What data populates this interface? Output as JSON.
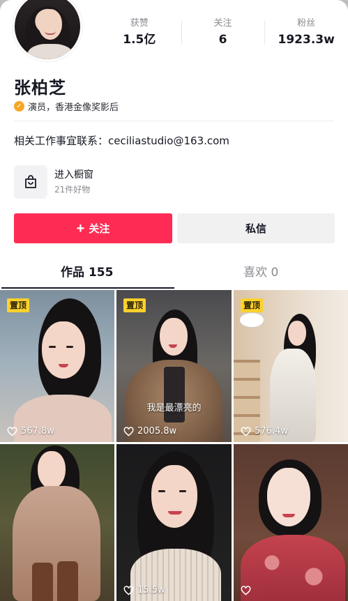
{
  "profile": {
    "name": "张柏芝",
    "verification": "演员，香港金像奖影后",
    "contact": "相关工作事宜联系：ceciliastudio@163.com"
  },
  "stats": [
    {
      "label": "获赞",
      "value": "1.5亿"
    },
    {
      "label": "关注",
      "value": "6"
    },
    {
      "label": "粉丝",
      "value": "1923.3w"
    }
  ],
  "shop": {
    "title": "进入橱窗",
    "subtitle": "21件好物",
    "icon": "shopping-bag-icon"
  },
  "actions": {
    "follow_label": "关注",
    "message_label": "私信"
  },
  "tabs": [
    {
      "label": "作品 155",
      "active": true
    },
    {
      "label": "喜欢 0",
      "active": false
    }
  ],
  "videos": [
    {
      "pinned": true,
      "pin_label": "置顶",
      "likes": "567.8w",
      "caption": ""
    },
    {
      "pinned": true,
      "pin_label": "置顶",
      "likes": "2005.8w",
      "caption": "我是最漂亮的"
    },
    {
      "pinned": true,
      "pin_label": "置顶",
      "likes": "576.4w",
      "caption": ""
    },
    {
      "pinned": false,
      "pin_label": "",
      "likes": "",
      "caption": ""
    },
    {
      "pinned": false,
      "pin_label": "",
      "likes": "15.5w",
      "caption": ""
    },
    {
      "pinned": false,
      "pin_label": "",
      "likes": "",
      "caption": ""
    }
  ],
  "colors": {
    "accent": "#fe2c55",
    "pin": "#fdd12e",
    "verified": "#f5a623"
  }
}
